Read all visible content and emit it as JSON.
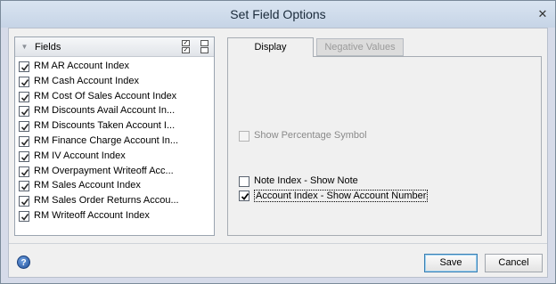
{
  "window": {
    "title": "Set Field Options",
    "close_glyph": "✕"
  },
  "fields_panel": {
    "header_label": "Fields",
    "items": [
      {
        "label": "RM AR Account Index",
        "checked": true
      },
      {
        "label": "RM Cash Account Index",
        "checked": true
      },
      {
        "label": "RM Cost Of Sales Account Index",
        "checked": true
      },
      {
        "label": "RM Discounts Avail Account In...",
        "checked": true
      },
      {
        "label": "RM Discounts Taken Account I...",
        "checked": true
      },
      {
        "label": "RM Finance Charge Account In...",
        "checked": true
      },
      {
        "label": "RM IV Account Index",
        "checked": true
      },
      {
        "label": "RM Overpayment Writeoff Acc...",
        "checked": true
      },
      {
        "label": "RM Sales Account Index",
        "checked": true
      },
      {
        "label": "RM Sales Order Returns Accou...",
        "checked": true
      },
      {
        "label": "RM Writeoff Account Index",
        "checked": true
      }
    ]
  },
  "tabs": [
    {
      "label": "Display",
      "active": true
    },
    {
      "label": "Negative Values",
      "active": false,
      "enabled": false
    }
  ],
  "display_options": {
    "show_percentage": {
      "label": "Show Percentage Symbol",
      "checked": false,
      "enabled": false
    },
    "note_index": {
      "label": "Note Index - Show Note",
      "checked": false,
      "enabled": true
    },
    "account_index": {
      "label": "Account Index - Show Account Number",
      "checked": true,
      "enabled": true
    }
  },
  "buttons": {
    "save": "Save",
    "cancel": "Cancel"
  },
  "help_glyph": "?"
}
